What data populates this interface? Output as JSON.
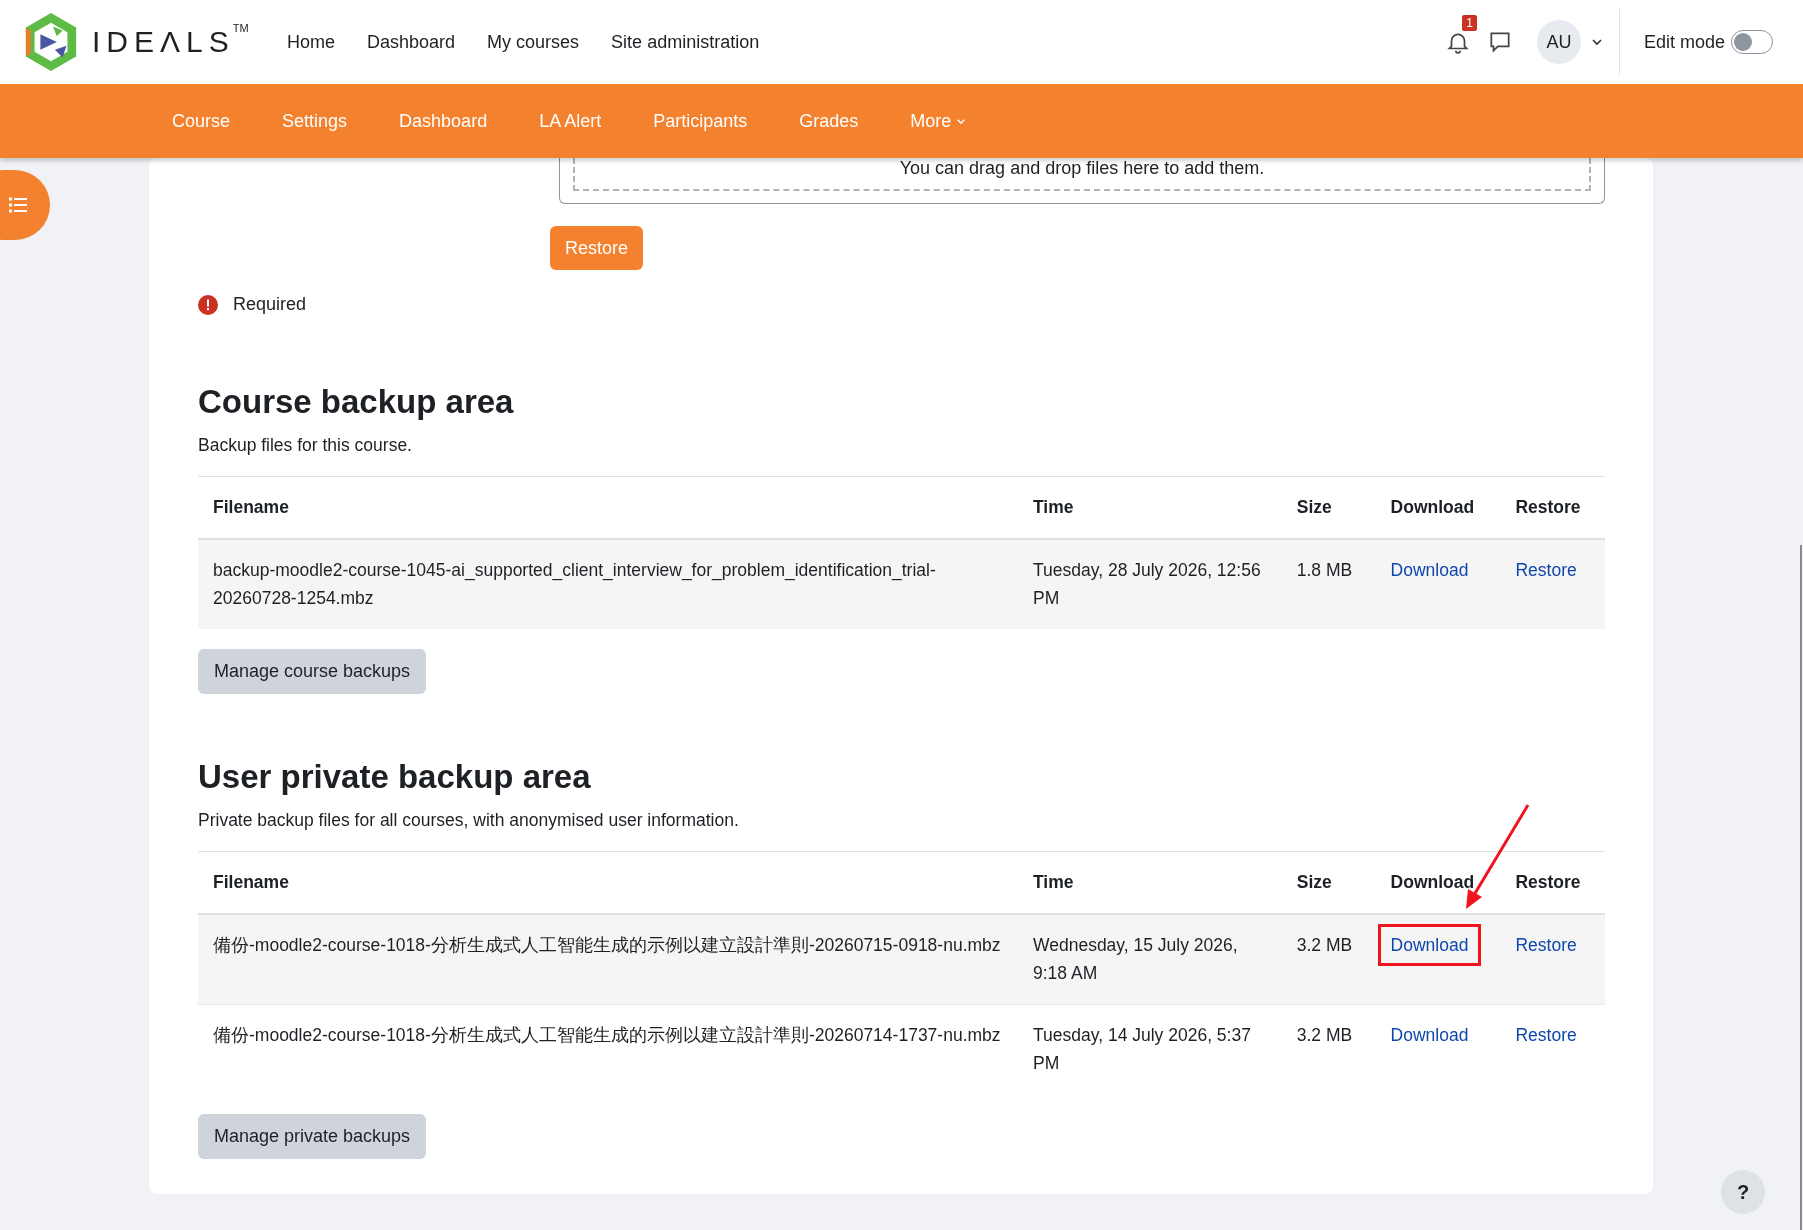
{
  "brand": {
    "name": "IDEΛLS",
    "mark": "TM"
  },
  "top_nav": [
    {
      "label": "Home"
    },
    {
      "label": "Dashboard"
    },
    {
      "label": "My courses"
    },
    {
      "label": "Site administration"
    }
  ],
  "notifications": {
    "count": "1"
  },
  "user": {
    "initials": "AU"
  },
  "edit_mode": {
    "label": "Edit mode",
    "on": false
  },
  "course_nav": [
    {
      "label": "Course",
      "caret": false
    },
    {
      "label": "Settings",
      "caret": false
    },
    {
      "label": "Dashboard",
      "caret": false
    },
    {
      "label": "LA Alert",
      "caret": false
    },
    {
      "label": "Participants",
      "caret": false
    },
    {
      "label": "Grades",
      "caret": false
    },
    {
      "label": "More",
      "caret": true
    }
  ],
  "dropzone": {
    "text": "You can drag and drop files here to add them."
  },
  "restore_button": "Restore",
  "required_note": "Required",
  "sections": [
    {
      "title": "Course backup area",
      "description": "Backup files for this course.",
      "columns": [
        "Filename",
        "Time",
        "Size",
        "Download",
        "Restore"
      ],
      "rows": [
        {
          "filename": "backup-moodle2-course-1045-ai_supported_client_interview_for_problem_identification_trial-20260728-1254.mbz",
          "time": "Tuesday, 28 July 2026, 12:56 PM",
          "size": "1.8 MB",
          "download": "Download",
          "restore": "Restore",
          "highlighted": false
        }
      ],
      "manage_button": "Manage course backups"
    },
    {
      "title": "User private backup area",
      "description": "Private backup files for all courses, with anonymised user information.",
      "columns": [
        "Filename",
        "Time",
        "Size",
        "Download",
        "Restore"
      ],
      "rows": [
        {
          "filename": "備份-moodle2-course-1018-分析生成式人工智能生成的示例以建立設計準則-20260715-0918-nu.mbz",
          "time": "Wednesday, 15 July 2026, 9:18 AM",
          "size": "3.2 MB",
          "download": "Download",
          "restore": "Restore",
          "highlighted": true
        },
        {
          "filename": "備份-moodle2-course-1018-分析生成式人工智能生成的示例以建立設計準則-20260714-1737-nu.mbz",
          "time": "Tuesday, 14 July 2026, 5:37 PM",
          "size": "3.2 MB",
          "download": "Download",
          "restore": "Restore",
          "highlighted": false
        }
      ],
      "manage_button": "Manage private backups"
    }
  ],
  "help_button": "?"
}
